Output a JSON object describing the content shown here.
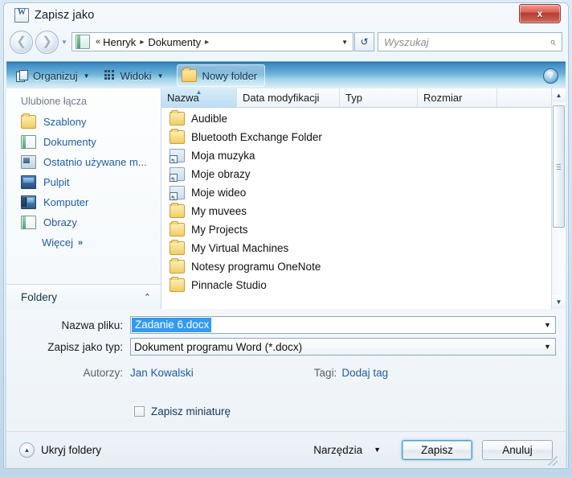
{
  "window": {
    "title": "Zapisz jako",
    "title_icon": "word-document-icon",
    "close_label": "x"
  },
  "nav": {
    "back_icon": "back-arrow-icon",
    "forward_icon": "forward-arrow-icon",
    "history_icon": "chevron-down-icon",
    "breadcrumb_icon": "documents-folder-icon",
    "breadcrumb_overflow": "«",
    "breadcrumb": [
      "Henryk",
      "Dokumenty"
    ],
    "separator": "▸",
    "dropdown_icon": "chevron-down-icon",
    "refresh_icon": "refresh-icon",
    "refresh_glyph": "↺"
  },
  "search": {
    "placeholder": "Wyszukaj",
    "icon": "search-icon",
    "glyph": "⌕"
  },
  "toolbar": {
    "organize_label": "Organizuj",
    "organize_icon": "organize-icon",
    "views_label": "Widoki",
    "views_icon": "views-grid-icon",
    "new_folder_label": "Nowy folder",
    "new_folder_icon": "new-folder-icon",
    "caret": "▼",
    "help_label": "?",
    "help_icon": "help-icon"
  },
  "sidebar": {
    "header": "Ulubione łącza",
    "items": [
      {
        "label": "Szablony",
        "icon": "folder-icon",
        "icon_class": "ico-folder"
      },
      {
        "label": "Dokumenty",
        "icon": "documents-icon",
        "icon_class": "ico-doc"
      },
      {
        "label": "Ostatnio używane m...",
        "icon": "recent-places-icon",
        "icon_class": "ico-recent"
      },
      {
        "label": "Pulpit",
        "icon": "desktop-icon",
        "icon_class": "ico-desktop"
      },
      {
        "label": "Komputer",
        "icon": "computer-icon",
        "icon_class": "ico-computer"
      },
      {
        "label": "Obrazy",
        "icon": "pictures-icon",
        "icon_class": "ico-doc"
      }
    ],
    "more_label": "Więcej",
    "more_chevron": "»",
    "folders_label": "Foldery",
    "folders_chevron": "⌃"
  },
  "filelist": {
    "columns": [
      {
        "label": "Nazwa",
        "sorted": true,
        "sort_glyph": "▲"
      },
      {
        "label": "Data modyfikacji",
        "sorted": false
      },
      {
        "label": "Typ",
        "sorted": false
      },
      {
        "label": "Rozmiar",
        "sorted": false
      }
    ],
    "overflow_label": "»",
    "rows": [
      {
        "name": "Audible",
        "icon": "folder-icon",
        "icon_class": "ico-folder"
      },
      {
        "name": "Bluetooth Exchange Folder",
        "icon": "folder-icon",
        "icon_class": "ico-folder"
      },
      {
        "name": "Moja muzyka",
        "icon": "shortcut-icon",
        "icon_class": "ico-shortcut"
      },
      {
        "name": "Moje obrazy",
        "icon": "shortcut-icon",
        "icon_class": "ico-shortcut"
      },
      {
        "name": "Moje wideo",
        "icon": "shortcut-icon",
        "icon_class": "ico-shortcut"
      },
      {
        "name": "My muvees",
        "icon": "folder-icon",
        "icon_class": "ico-folder"
      },
      {
        "name": "My Projects",
        "icon": "folder-icon",
        "icon_class": "ico-folder"
      },
      {
        "name": "My Virtual Machines",
        "icon": "folder-icon",
        "icon_class": "ico-folder"
      },
      {
        "name": "Notesy programu OneNote",
        "icon": "folder-icon",
        "icon_class": "ico-folder"
      },
      {
        "name": "Pinnacle Studio",
        "icon": "folder-icon",
        "icon_class": "ico-folder"
      }
    ],
    "scrollbar": {
      "up_glyph": "▲",
      "down_glyph": "▼"
    }
  },
  "form": {
    "filename_label": "Nazwa pliku:",
    "filename_value": "Zadanie 6.docx",
    "filename_selected": true,
    "filetype_label": "Zapisz jako typ:",
    "filetype_value": "Dokument programu Word (*.docx)",
    "combo_caret": "▼",
    "authors_label": "Autorzy:",
    "authors_value": "Jan Kowalski",
    "tags_label": "Tagi:",
    "tags_value": "Dodaj tag",
    "thumbnail_label": "Zapisz miniaturę",
    "thumbnail_checked": false
  },
  "footer": {
    "hide_folders_label": "Ukryj foldery",
    "hide_folders_icon": "chevron-up-icon",
    "hide_folders_glyph": "▲",
    "tools_label": "Narzędzia",
    "tools_caret": "▼",
    "save_label": "Zapisz",
    "cancel_label": "Anuluj"
  },
  "colors": {
    "accent_blue": "#1f5c9e",
    "selection_blue": "#3399f2",
    "toolbar_top": "#1f6ba8",
    "close_red": "#b43c2f"
  }
}
